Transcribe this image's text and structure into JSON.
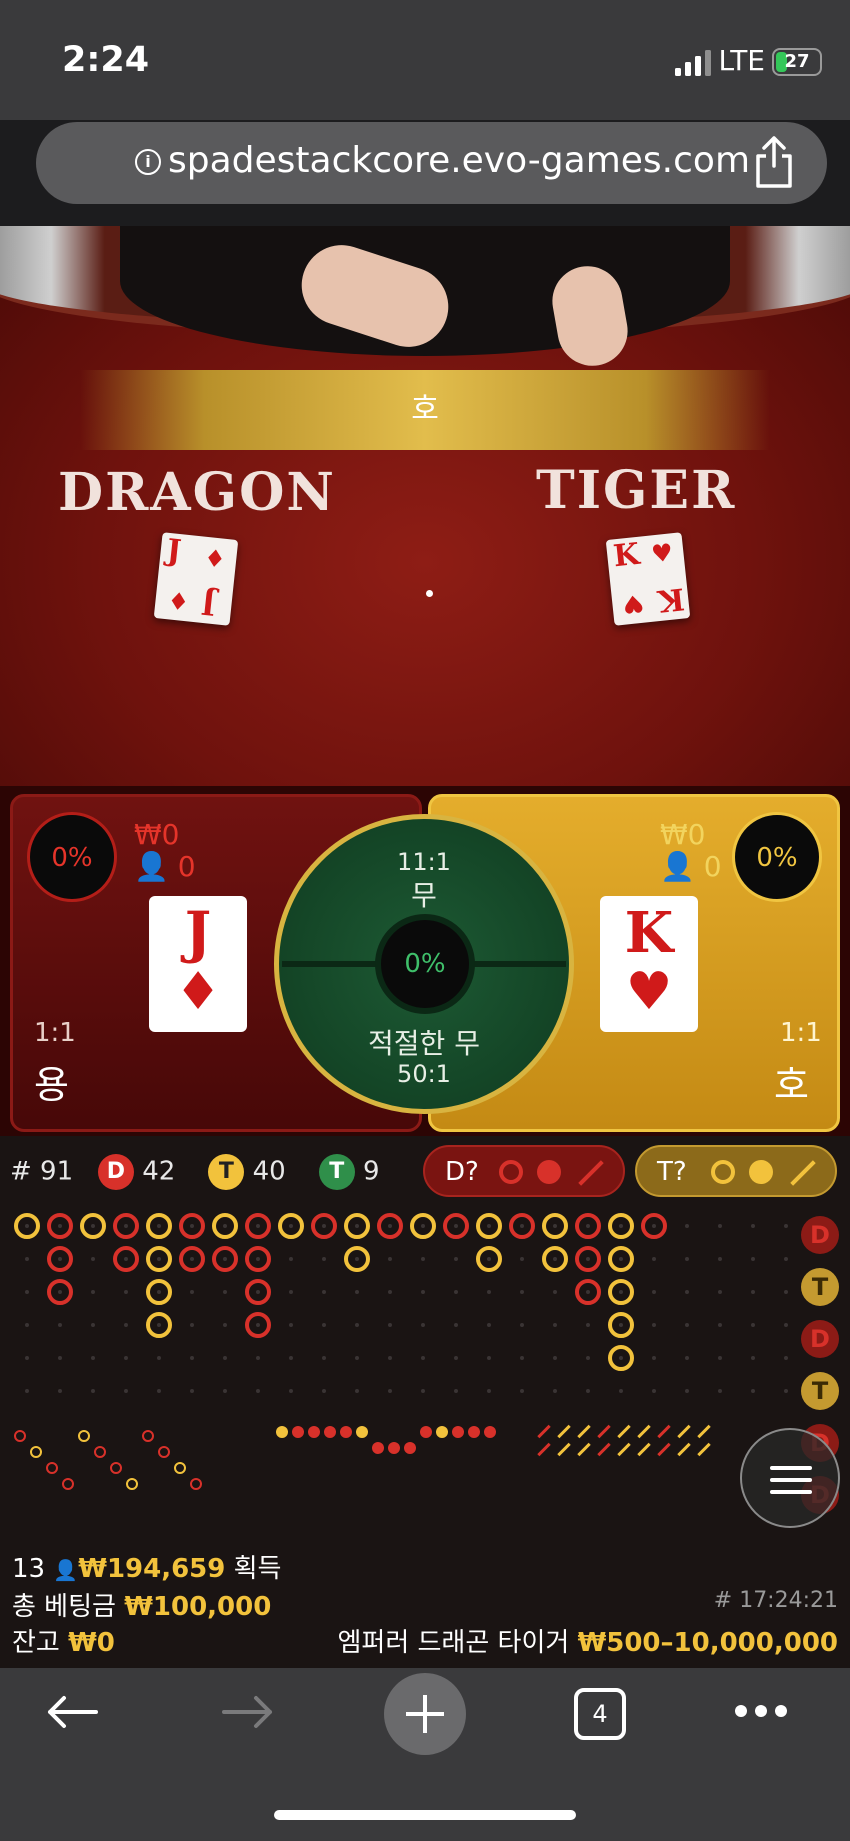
{
  "status_bar": {
    "time": "2:24",
    "network": "LTE",
    "battery": "27",
    "battery_level": 0.27,
    "icons": [
      "signal-bars-icon",
      "battery-charging-icon"
    ]
  },
  "browser": {
    "url": "spadestackcore.evo-games.com",
    "open_tabs": "4",
    "icons": [
      "info-icon",
      "share-icon",
      "back-arrow-icon",
      "forward-arrow-icon",
      "new-tab-plus-icon",
      "tabs-icon",
      "more-icon"
    ]
  },
  "video": {
    "banner": "호",
    "dragon_word": "DRAGON",
    "tiger_word": "TIGER",
    "dragon_card": {
      "rank": "J",
      "suit": "♦"
    },
    "tiger_card": {
      "rank": "K",
      "suit": "♥"
    }
  },
  "bets": {
    "dragon": {
      "percent": "0%",
      "won": "₩0",
      "players": "0",
      "odds": "1:1",
      "name": "용",
      "card_rank": "J",
      "card_suit": "♦"
    },
    "tiger": {
      "percent": "0%",
      "won": "₩0",
      "players": "0",
      "odds": "1:1",
      "name": "호",
      "card_rank": "K",
      "card_suit": "♥"
    },
    "tie": {
      "odds": "11:1",
      "name": "무",
      "percent": "0%"
    },
    "suited_tie": {
      "name": "적절한 무",
      "odds": "50:1"
    }
  },
  "stats": {
    "rounds_label": "# 91",
    "dragon_badge": "D",
    "dragon_count": "42",
    "tiger_badge": "T",
    "tiger_count": "40",
    "tie_badge": "T",
    "tie_count": "9"
  },
  "predictions": {
    "dragon": "D?",
    "tiger": "T?"
  },
  "big_road_labels": [
    "D",
    "T",
    "D",
    "T",
    "D",
    "D"
  ],
  "colors": {
    "dragon": "#d8312a",
    "tiger": "#f2c23c",
    "tie": "#2f8f4a",
    "felt": "#7a1610"
  },
  "footer": {
    "players": "13",
    "winnings": "₩194,659",
    "winnings_label": "획득",
    "total_bet_label": "총 베팅금",
    "total_bet": "₩100,000",
    "balance_label": "잔고",
    "balance": "₩0",
    "game_id": "# 17:24:21",
    "table_name": "엠퍼러 드래곤 타이거",
    "limits": "₩500–10,000,000"
  }
}
